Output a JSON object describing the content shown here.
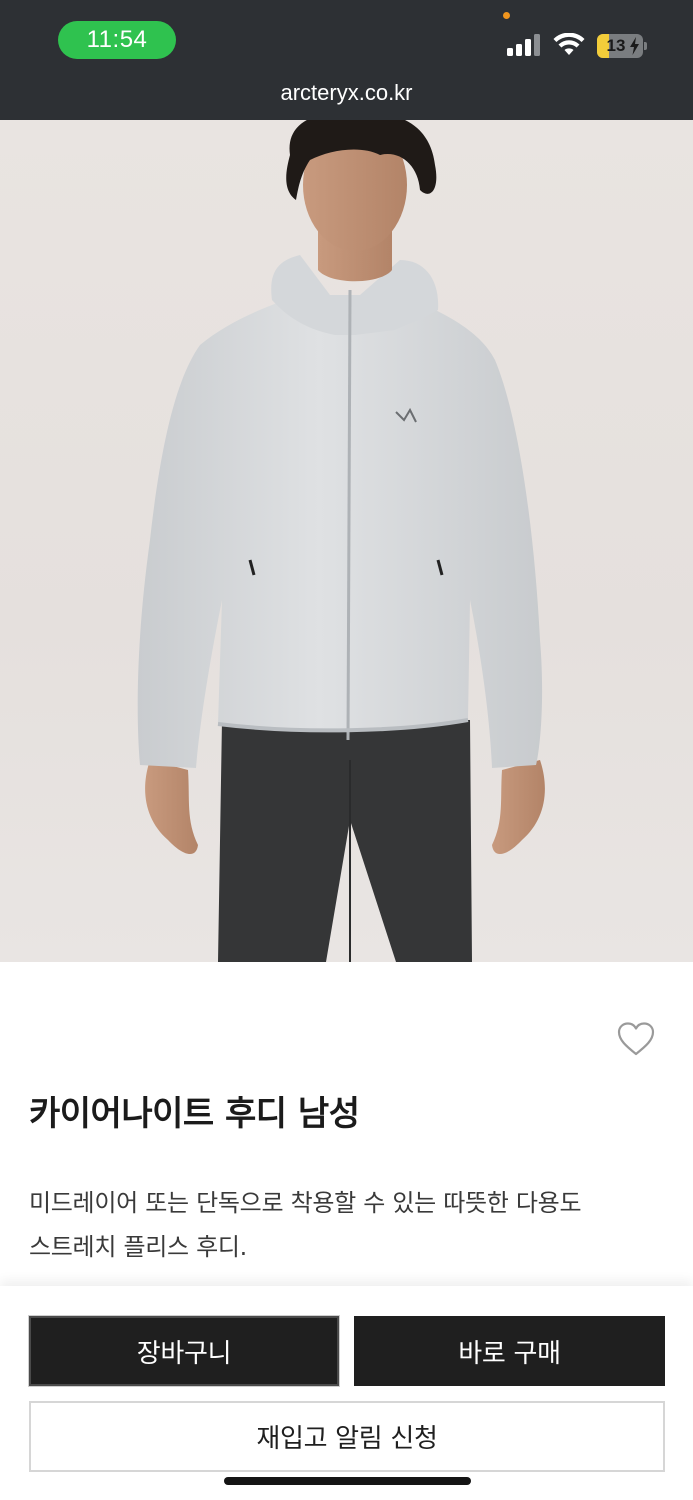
{
  "status_bar": {
    "time": "11:54",
    "battery_level": "13",
    "battery_fraction": 0.13,
    "signal_bars_active": 3,
    "signal_bars_total": 4,
    "icons": [
      "signal-icon",
      "wifi-icon",
      "battery-charging-icon"
    ]
  },
  "browser": {
    "url": "arcteryx.co.kr"
  },
  "product": {
    "image_alt": "카이어나이트 후디 남성",
    "title": "카이어나이트 후디 남성",
    "description_line1": "미드레이어 또는 단독으로 착용할 수 있는 따뜻한 다용도",
    "description_line2": "스트레치 플리스 후디.",
    "wishlist_icon": "heart-outline-icon"
  },
  "actions": {
    "cart_label": "장바구니",
    "buy_now_label": "바로 구매",
    "restock_label": "재입고 알림 신청"
  },
  "colors": {
    "status_bar_bg": "#2d3034",
    "time_pill": "#2fc24f",
    "primary_button": "#1f1f1f",
    "battery_fill": "#f3cd3a"
  }
}
